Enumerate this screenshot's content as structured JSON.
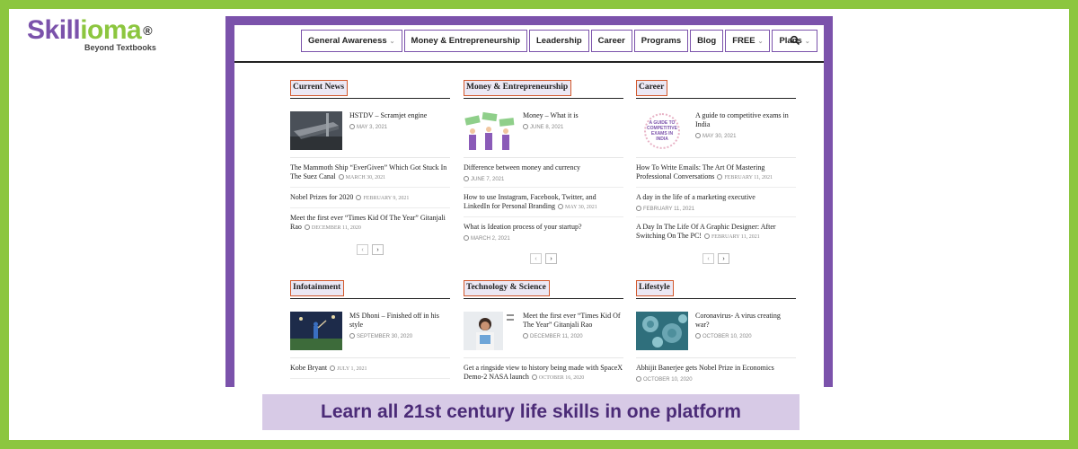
{
  "brand": {
    "logo_part1": "Skill",
    "logo_part2": "ioma",
    "logo_reg": "®",
    "tagline_small": "Beyond Textbooks",
    "colors": {
      "green": "#8cc63f",
      "purple": "#7b52ab",
      "highlight_border": "#d2582c"
    }
  },
  "nav": {
    "items": [
      {
        "label": "General Awareness",
        "has_dropdown": true
      },
      {
        "label": "Money & Entrepreneurship",
        "has_dropdown": false
      },
      {
        "label": "Leadership",
        "has_dropdown": false
      },
      {
        "label": "Career",
        "has_dropdown": false
      },
      {
        "label": "Programs",
        "has_dropdown": false
      },
      {
        "label": "Blog",
        "has_dropdown": false
      },
      {
        "label": "FREE",
        "has_dropdown": true
      },
      {
        "label": "Plans",
        "has_dropdown": true
      }
    ],
    "search_icon": "search-icon",
    "chevron": "⌄"
  },
  "sections": {
    "current_news": {
      "title": "Current News",
      "featured": {
        "title": "HSTDV – Scramjet engine",
        "date": "MAY 3, 2021"
      },
      "items": [
        {
          "title": "The Mammoth Ship “EverGiven” Which Got Stuck In The Suez Canal",
          "date": "MARCH 30, 2021"
        },
        {
          "title": "Nobel Prizes for 2020",
          "date": "FEBRUARY 9, 2021"
        },
        {
          "title": "Meet the first ever “Times Kid Of The Year” Gitanjali Rao",
          "date": "DECEMBER 11, 2020"
        }
      ]
    },
    "money": {
      "title": "Money & Entrepreneurship",
      "featured": {
        "title": "Money – What it is",
        "date": "JUNE 8, 2021"
      },
      "items": [
        {
          "title": "Difference between money and currency",
          "date": "JUNE 7, 2021"
        },
        {
          "title": "How to use Instagram, Facebook, Twitter, and LinkedIn for Personal Branding",
          "date": "MAY 30, 2021"
        },
        {
          "title": "What is Ideation process of your startup?",
          "date": "MARCH 2, 2021"
        }
      ]
    },
    "career": {
      "title": "Career",
      "featured": {
        "title": "A guide to competitive exams in India",
        "date": "MAY 30, 2021",
        "thumb_text": "A GUIDE TO COMPETITIVE EXAMS IN INDIA"
      },
      "items": [
        {
          "title": "How To Write Emails: The Art Of Mastering Professional Conversations",
          "date": "FEBRUARY 11, 2021"
        },
        {
          "title": "A day in the life of a marketing executive",
          "date": "FEBRUARY 11, 2021"
        },
        {
          "title": "A Day In The Life Of A Graphic Designer: After Switching On The PC!",
          "date": "FEBRUARY 11, 2021"
        }
      ]
    },
    "infotainment": {
      "title": "Infotainment",
      "featured": {
        "title": "MS Dhoni – Finished off in his style",
        "date": "SEPTEMBER 30, 2020"
      },
      "items": [
        {
          "title": "Kobe Bryant",
          "date": "JULY 1, 2021"
        }
      ]
    },
    "technology": {
      "title": "Technology & Science",
      "featured": {
        "title": "Meet the first ever “Times Kid Of The Year” Gitanjali Rao",
        "date": "DECEMBER 11, 2020"
      },
      "items": [
        {
          "title": "Get a ringside view to history being made with SpaceX Demo-2 NASA launch",
          "date": "OCTOBER 16, 2020"
        }
      ]
    },
    "lifestyle": {
      "title": "Lifestyle",
      "featured": {
        "title": "Coronavirus- A virus creating war?",
        "date": "OCTOBER 10, 2020"
      },
      "items": [
        {
          "title": "Abhijit Banerjee gets Nobel Prize in Economics",
          "date": "OCTOBER 10, 2020"
        }
      ]
    }
  },
  "pager": {
    "prev": "‹",
    "next": "›"
  },
  "tagline": "Learn all 21st century life skills in one platform"
}
